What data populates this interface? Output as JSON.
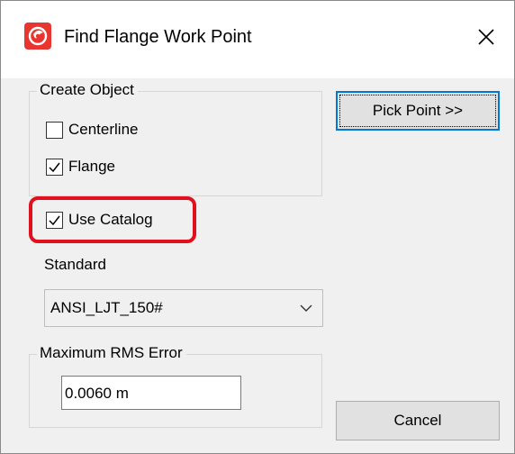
{
  "window": {
    "title": "Find Flange Work Point",
    "app_icon": "autodesk-logo-icon",
    "close_icon": "close-icon"
  },
  "create_object": {
    "legend": "Create Object",
    "centerline": {
      "label": "Centerline",
      "checked": false
    },
    "flange": {
      "label": "Flange",
      "checked": true
    }
  },
  "use_catalog": {
    "label": "Use Catalog",
    "checked": true,
    "highlight_color": "#e0101d"
  },
  "standard": {
    "label": "Standard",
    "selected": "ANSI_LJT_150#"
  },
  "rms": {
    "legend": "Maximum RMS Error",
    "value": "0.0060 m"
  },
  "buttons": {
    "pick_point": "Pick Point >>",
    "cancel": "Cancel"
  },
  "colors": {
    "accent": "#0078d7",
    "icon_red": "#e8352f"
  }
}
